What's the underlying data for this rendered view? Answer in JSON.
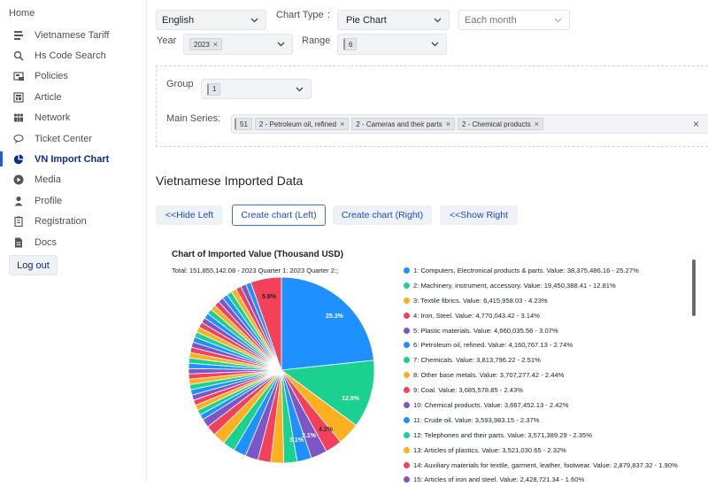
{
  "sidebar": {
    "home": "Home",
    "items": [
      {
        "label": "Vietnamese Tariff",
        "icon": "book-icon"
      },
      {
        "label": "Hs Code Search",
        "icon": "search-icon"
      },
      {
        "label": "Policies",
        "icon": "policies-icon"
      },
      {
        "label": "Article",
        "icon": "article-icon"
      },
      {
        "label": "Network",
        "icon": "network-icon"
      },
      {
        "label": "Ticket Center",
        "icon": "chat-icon"
      },
      {
        "label": "VN Import Chart",
        "icon": "pie-chart-icon",
        "active": true
      },
      {
        "label": "Media",
        "icon": "play-icon"
      },
      {
        "label": "Profile",
        "icon": "user-icon"
      },
      {
        "label": "Registration",
        "icon": "clipboard-icon"
      },
      {
        "label": "Docs",
        "icon": "document-icon"
      }
    ],
    "logout": "Log out",
    "active_color": "#0d2b8a"
  },
  "filters": {
    "language": "English",
    "chart_type_label": "Chart Type",
    "chart_type_colon": ":",
    "chart_type": "Pie Chart",
    "period_placeholder": "Each month",
    "year_label": "Year",
    "year_tag": "2023",
    "range_label": "Range",
    "range_tag": "6",
    "group_label": "Group",
    "group_tag": "1",
    "main_series_label": "Main Series:",
    "series_tags": [
      "51",
      "2 - Petroleum oil, refined",
      "2 - Cameras and their parts",
      "2 - Chemical products"
    ]
  },
  "main": {
    "heading": "Vietnamese Imported Data",
    "buttons": {
      "hide_left": "<<Hide Left",
      "create_left": "Create chart (Left)",
      "create_right": "Create chart (Right)",
      "show_right": "<<Show Right"
    }
  },
  "chart_data": {
    "type": "pie",
    "title": "Chart of Imported Value (Thousand USD)",
    "subtitle": "Total: 151,855,142.08 - 2023 Quarter 1: 2023 Quarter 2:;",
    "slice_labels": [
      "25.3%",
      "12.8%",
      "4.2%",
      "3.1%",
      "3.1%",
      "5.8%"
    ],
    "legend": [
      {
        "text": "1: Computers, Electronical products & parts. Value: 38,375,486.16 - 25.27%",
        "value": 25.27,
        "color": "#1e90ff"
      },
      {
        "text": "2: Machinery, instrument, accessory. Value: 19,450,388.41 - 12.81%",
        "value": 12.81,
        "color": "#1bd190"
      },
      {
        "text": "3: Textile fibrics. Value: 6,415,958.03 - 4.23%",
        "value": 4.23,
        "color": "#ffb020"
      },
      {
        "text": "4: Iron, Steel. Value: 4,770,043.42 - 3.14%",
        "value": 3.14,
        "color": "#f5405a"
      },
      {
        "text": "5: Plastic materials. Value: 4,660,035.56 - 3.07%",
        "value": 3.07,
        "color": "#7d55c7"
      },
      {
        "text": "6: Petroleum oil, refined. Value: 4,160,767.13 - 2.74%",
        "value": 2.74,
        "color": "#1e90ff"
      },
      {
        "text": "7: Chemicals. Value: 3,813,796.22 - 2.51%",
        "value": 2.51,
        "color": "#1bd190"
      },
      {
        "text": "8: Other base metals. Value: 3,707,277.42 - 2.44%",
        "value": 2.44,
        "color": "#ffb020"
      },
      {
        "text": "9: Coal. Value: 3,685,578.85 - 2.43%",
        "value": 2.43,
        "color": "#f5405a"
      },
      {
        "text": "10: Chemical products. Value: 3,667,452.13 - 2.42%",
        "value": 2.42,
        "color": "#7d55c7"
      },
      {
        "text": "11: Crude oil. Value: 3,593,983.15 - 2.37%",
        "value": 2.37,
        "color": "#1e90ff"
      },
      {
        "text": "12: Telephones and their parts. Value: 3,571,389.29 - 2.35%",
        "value": 2.35,
        "color": "#1bd190"
      },
      {
        "text": "13: Articles of plastics. Value: 3,521,030.65 - 2.32%",
        "value": 2.32,
        "color": "#ffb020"
      },
      {
        "text": "14: Auxiliary materials for textile, garment, leather, footwear. Value: 2,879,837.32 - 1.90%",
        "value": 1.9,
        "color": "#f5405a"
      },
      {
        "text": "15: Articles of iron and steel. Value: 2,428,721.34 - 1.60%",
        "value": 1.6,
        "color": "#7d55c7"
      }
    ],
    "other_slices_percent": 31.0,
    "last_slice_percent": 5.8
  }
}
